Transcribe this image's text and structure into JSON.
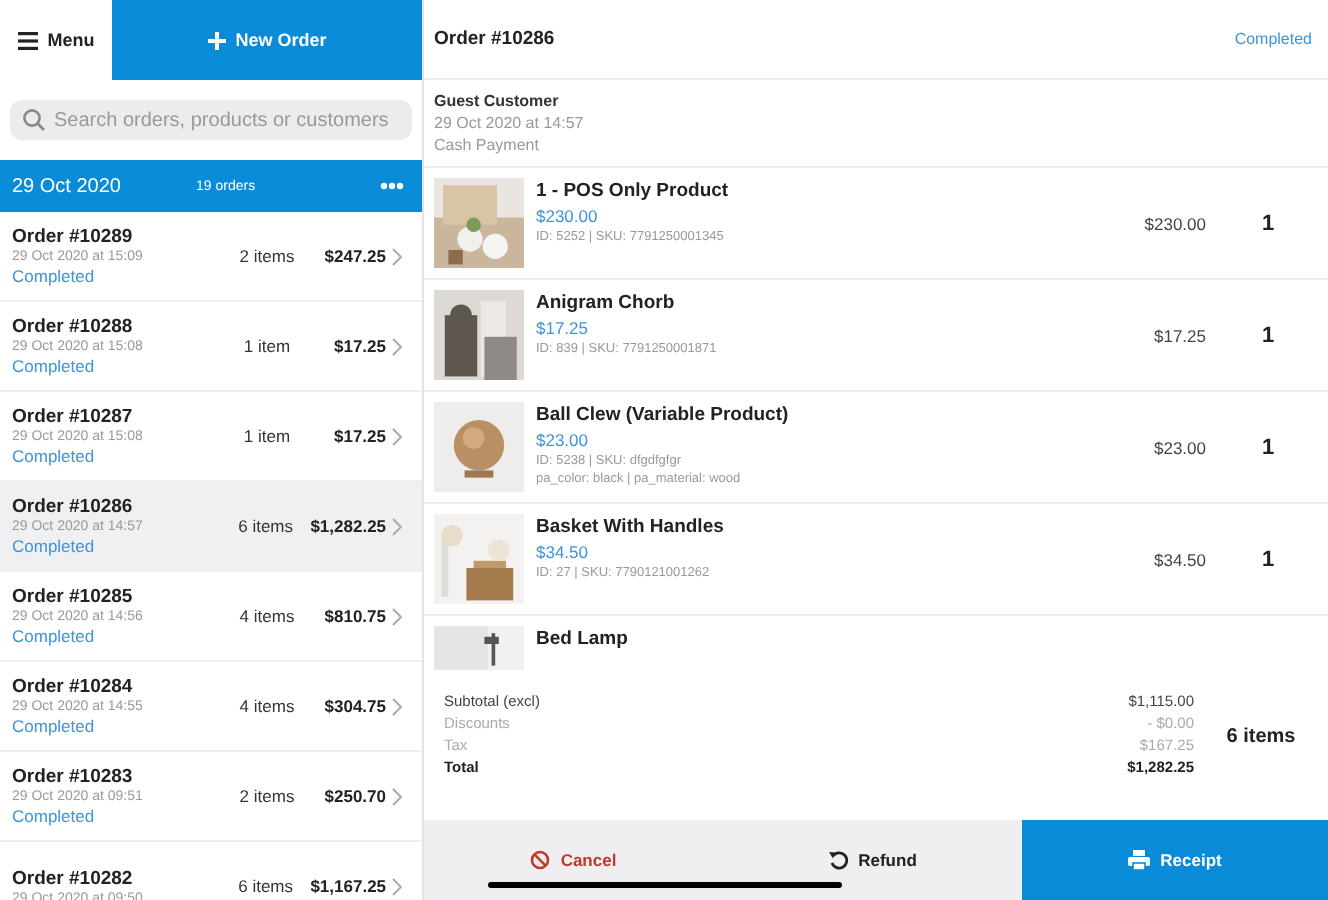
{
  "header": {
    "menu_label": "Menu",
    "new_order_label": "New Order"
  },
  "search": {
    "placeholder": "Search orders, products or customers"
  },
  "date_group": {
    "date": "29 Oct 2020",
    "count": "19 orders"
  },
  "orders": [
    {
      "number": "Order #10289",
      "time": "29 Oct 2020 at 15:09",
      "status": "Completed",
      "items": "2 items",
      "total": "$247.25",
      "selected": false
    },
    {
      "number": "Order #10288",
      "time": "29 Oct 2020 at 15:08",
      "status": "Completed",
      "items": "1 item",
      "total": "$17.25",
      "selected": false
    },
    {
      "number": "Order #10287",
      "time": "29 Oct 2020 at 15:08",
      "status": "Completed",
      "items": "1 item",
      "total": "$17.25",
      "selected": false
    },
    {
      "number": "Order #10286",
      "time": "29 Oct 2020 at 14:57",
      "status": "Completed",
      "items": "6 items",
      "total": "$1,282.25",
      "selected": true
    },
    {
      "number": "Order #10285",
      "time": "29 Oct 2020 at 14:56",
      "status": "Completed",
      "items": "4 items",
      "total": "$810.75",
      "selected": false
    },
    {
      "number": "Order #10284",
      "time": "29 Oct 2020 at 14:55",
      "status": "Completed",
      "items": "4 items",
      "total": "$304.75",
      "selected": false
    },
    {
      "number": "Order #10283",
      "time": "29 Oct 2020 at 09:51",
      "status": "Completed",
      "items": "2 items",
      "total": "$250.70",
      "selected": false
    },
    {
      "number": "Order #10282",
      "time": "29 Oct 2020 at 09:50",
      "items": "6 items",
      "total": "$1,167.25",
      "selected": false
    }
  ],
  "detail": {
    "title": "Order #10286",
    "status": "Completed",
    "customer": "Guest Customer",
    "time": "29 Oct 2020 at 14:57",
    "payment": "Cash Payment",
    "line_items": [
      {
        "name": "1 - POS Only Product",
        "price": "$230.00",
        "meta": [
          "ID: 5252 | SKU: 7791250001345"
        ],
        "line_total": "$230.00",
        "qty": "1",
        "kind": "picture"
      },
      {
        "name": "Anigram Chorb",
        "price": "$17.25",
        "meta": [
          "ID: 839 | SKU: 7791250001871"
        ],
        "line_total": "$17.25",
        "qty": "1",
        "kind": "picture"
      },
      {
        "name": "Ball Clew (Variable Product)",
        "price": "$23.00",
        "meta": [
          "ID: 5238 | SKU: dfgdfgfgr",
          "pa_color: black | pa_material: wood"
        ],
        "line_total": "$23.00",
        "qty": "1",
        "kind": "picture"
      },
      {
        "name": "Basket With Handles",
        "price": "$34.50",
        "meta": [
          "ID: 27 | SKU: 7790121001262"
        ],
        "line_total": "$34.50",
        "qty": "1",
        "kind": "picture"
      },
      {
        "name": "Bed Lamp",
        "kind": "picture"
      }
    ],
    "totals": [
      {
        "label": "Subtotal (excl)",
        "value": "$1,115.00",
        "kind": "normal"
      },
      {
        "label": "Discounts",
        "value": "- $0.00",
        "kind": "muted"
      },
      {
        "label": "Tax",
        "value": "$167.25",
        "kind": "muted"
      },
      {
        "label": "Total",
        "value": "$1,282.25",
        "kind": "total"
      }
    ],
    "item_count": "6 items"
  },
  "actions": {
    "cancel": "Cancel",
    "refund": "Refund",
    "receipt": "Receipt"
  }
}
